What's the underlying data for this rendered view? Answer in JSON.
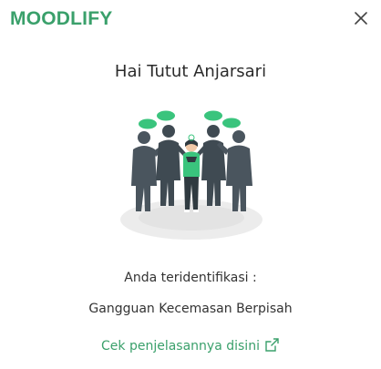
{
  "app": {
    "brand": "MOODLIFY",
    "brand_color": "#3aa06b"
  },
  "dialog": {
    "greeting": "Hai Tutut Anjarsari",
    "identified_label": "Anda teridentifikasi :",
    "diagnosis": "Gangguan Kecemasan Berpisah",
    "link_text": "Cek penjelasannya disini",
    "link_icon": "external-link-icon",
    "close_icon": "close-icon",
    "illustration": "crowd-pressure-illustration"
  }
}
